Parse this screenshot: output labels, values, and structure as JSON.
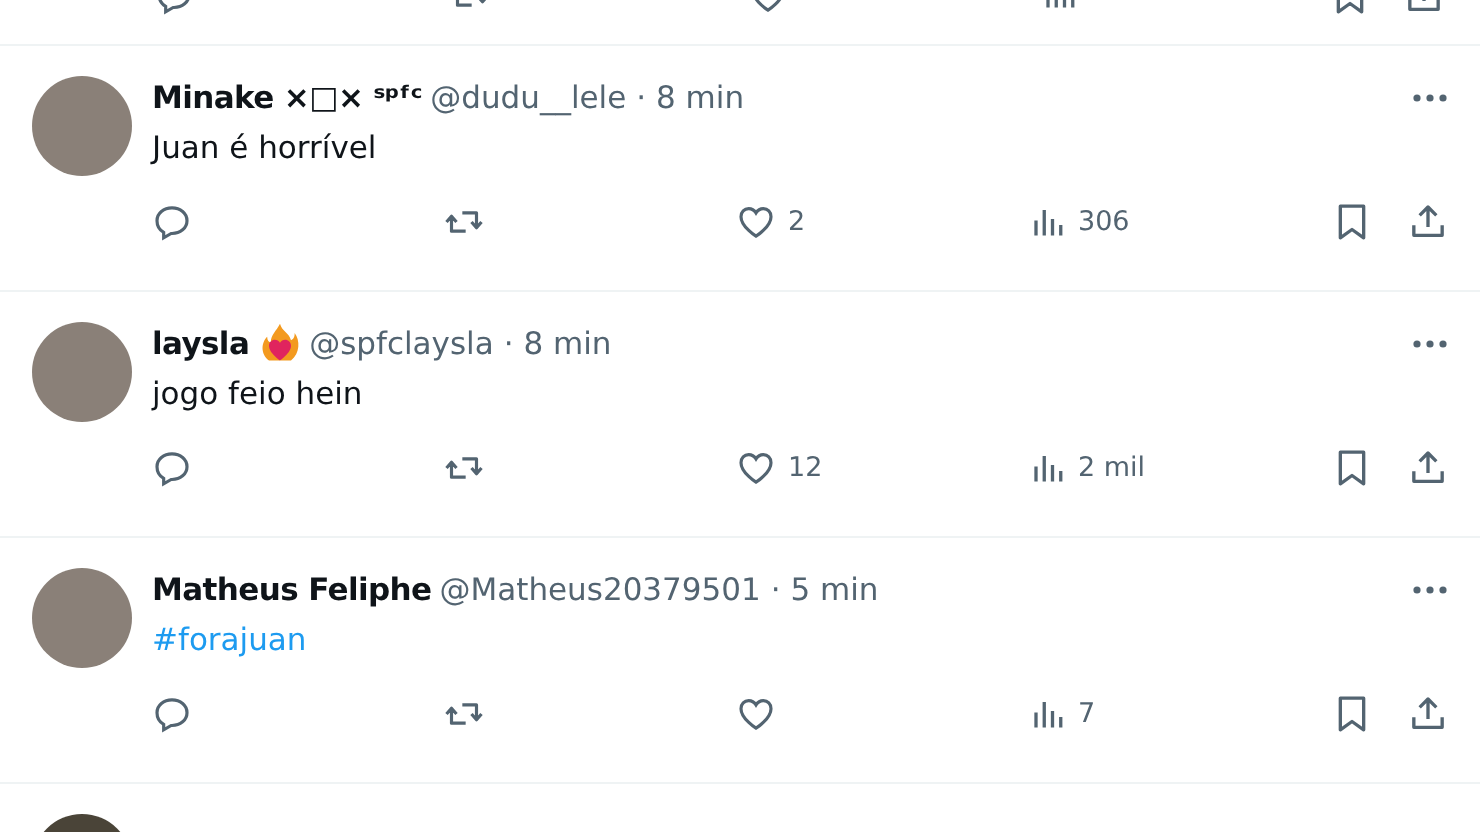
{
  "tweets": [
    {
      "name": "Minake ×□× ˢᵖᶠᶜ",
      "emoji_badge": false,
      "handle": "@dudu__lele",
      "time": "· 8 min",
      "body": {
        "kind": "text",
        "text": "Juan é horrível"
      },
      "likes": "2",
      "views": "306"
    },
    {
      "name": "laysla",
      "emoji_badge": true,
      "handle": "@spfclaysla",
      "time": "· 8 min",
      "body": {
        "kind": "text",
        "text": "jogo feio hein"
      },
      "likes": "12",
      "views": "2 mil"
    },
    {
      "name": "Matheus Feliphe",
      "emoji_badge": false,
      "handle": "@Matheus20379501",
      "time": "· 5 min",
      "body": {
        "kind": "hashtag",
        "text": "#forajuan"
      },
      "views": "7"
    }
  ]
}
